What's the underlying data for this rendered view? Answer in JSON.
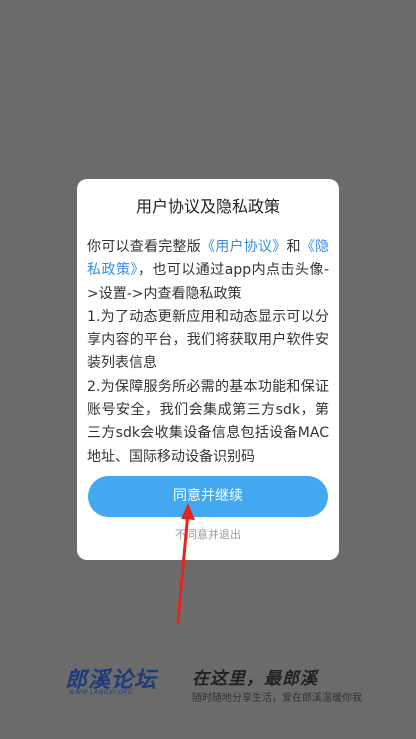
{
  "dialog": {
    "title": "用户协议及隐私政策",
    "body_prefix": "你可以查看完整版",
    "user_agreement_link": "《用户协议》",
    "body_and": "和",
    "privacy_policy_link": "《隐私政策》",
    "body_rest": "，也可以通过app内点击头像->设置->内查看隐私政策",
    "item1": "1.为了动态更新应用和动态显示可以分享内容的平台，我们将获取用户软件安装列表信息",
    "item2": "2.为保障服务所必需的基本功能和保证账号安全，我们会集成第三方sdk，第三方sdk会收集设备信息包括设备MAC地址、国际移动设备识别码",
    "agree_label": "同意并继续",
    "disagree_label": "不同意并退出"
  },
  "footer": {
    "logo_text": "郎溪论坛",
    "logo_subtext": "WWW.LANGXI.ORG",
    "slogan_main": "在这里，最郎溪",
    "slogan_sub": "随时随地分享生活，爱在郎溪温暖你我"
  },
  "colors": {
    "overlay": "#6b6b6b",
    "accent": "#42a8f0",
    "link": "#3a8ee6",
    "arrow": "#e52421"
  },
  "icons": {
    "arrow": "red-annotation-arrow"
  }
}
